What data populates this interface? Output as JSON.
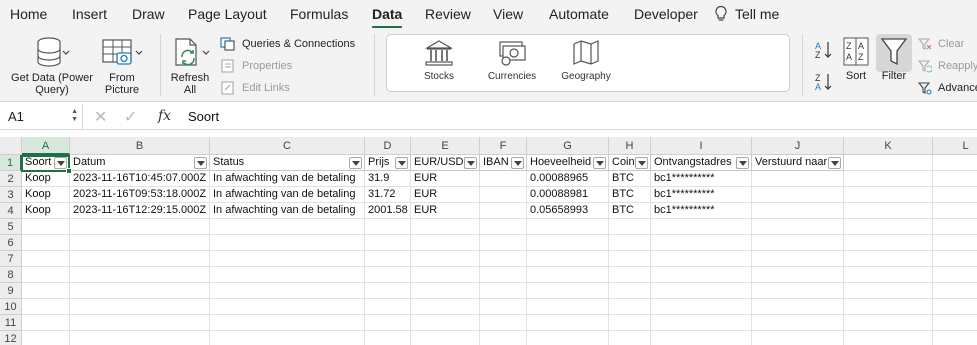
{
  "ribbon_tabs": [
    "Home",
    "Insert",
    "Draw",
    "Page Layout",
    "Formulas",
    "Data",
    "Review",
    "View",
    "Automate",
    "Developer"
  ],
  "active_tab": "Data",
  "tell_me": "Tell me",
  "ribbon": {
    "get_data": "Get Data (Power Query)",
    "get_data_line1": "Get Data (Power",
    "get_data_line2": "Query)",
    "from_picture_line1": "From",
    "from_picture_line2": "Picture",
    "refresh_line1": "Refresh",
    "refresh_line2": "All",
    "queries_connections": "Queries & Connections",
    "properties": "Properties",
    "edit_links": "Edit Links",
    "data_types": [
      "Stocks",
      "Currencies",
      "Geography"
    ],
    "sort": "Sort",
    "filter": "Filter",
    "clear": "Clear",
    "reapply": "Reapply",
    "advanced": "Advanced"
  },
  "formula_bar": {
    "name_box": "A1",
    "fx": "fx",
    "value": "Soort"
  },
  "columns": [
    "A",
    "B",
    "C",
    "D",
    "E",
    "F",
    "G",
    "H",
    "I",
    "J",
    "K",
    "L"
  ],
  "row_numbers": [
    "1",
    "2",
    "3",
    "4",
    "5",
    "6",
    "7",
    "8",
    "9",
    "10",
    "11",
    "12"
  ],
  "table": {
    "headers": [
      "Soort",
      "Datum",
      "Status",
      "Prijs",
      "EUR/USD",
      "IBAN",
      "Hoeveelheid",
      "Coin",
      "Ontvangstadres",
      "Verstuurd naar"
    ],
    "rows": [
      [
        "Koop",
        "2023-11-16T10:45:07.000Z",
        "In afwachting van de betaling",
        "31.9",
        "EUR",
        "",
        "0.00088965",
        "BTC",
        "bc1**********",
        ""
      ],
      [
        "Koop",
        "2023-11-16T09:53:18.000Z",
        "In afwachting van de betaling",
        "31.72",
        "EUR",
        "",
        "0.00088981",
        "BTC",
        "bc1**********",
        ""
      ],
      [
        "Koop",
        "2023-11-16T12:29:15.000Z",
        "In afwachting van de betaling",
        "2001.58",
        "EUR",
        "",
        "0.05658993",
        "BTC",
        "bc1**********",
        ""
      ]
    ]
  },
  "colors": {
    "accent": "#1e7145",
    "ribbon_bg": "#f3f3f3",
    "header_bg": "#ededed"
  }
}
